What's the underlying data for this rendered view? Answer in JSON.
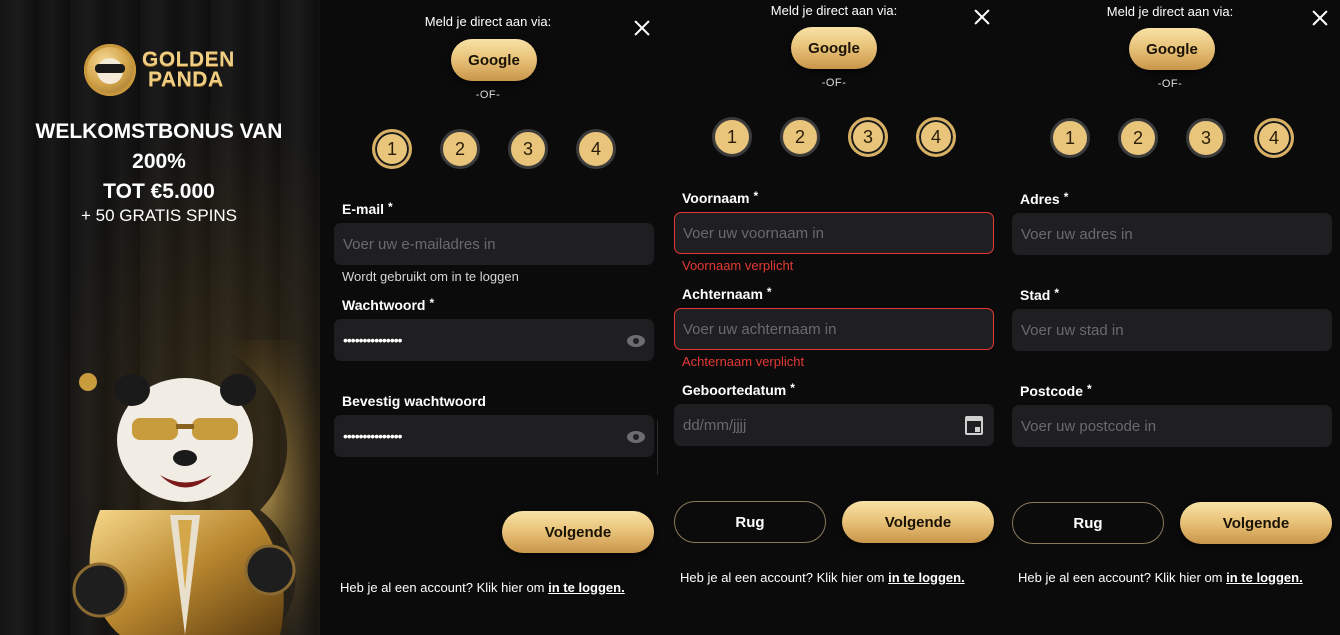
{
  "promo": {
    "logo_line1": "GOLDEN",
    "logo_line2": "PANDA",
    "headline_1": "WELKOMSTBONUS VAN",
    "headline_2": "200%",
    "headline_3": "TOT €5.000",
    "subline": "+ 50 GRATIS SPINS"
  },
  "common": {
    "meld_text": "Meld je direct aan via:",
    "google_label": "Google",
    "or_text": "-OF-",
    "steps": [
      "1",
      "2",
      "3",
      "4"
    ],
    "footer_text": "Heb je al een account? Klik hier om",
    "footer_link": "in te loggen.",
    "next_label": "Volgende",
    "back_label": "Rug",
    "required_mark": "*"
  },
  "step1": {
    "email_label": "E-mail",
    "email_placeholder": "Voer uw e-mailadres in",
    "email_hint": "Wordt gebruikt om in te loggen",
    "password_label": "Wachtwoord",
    "password_value": "•••••••••••••••",
    "confirm_label": "Bevestig wachtwoord",
    "confirm_value": "•••••••••••••••"
  },
  "step2": {
    "firstname_label": "Voornaam",
    "firstname_placeholder": "Voer uw voornaam in",
    "firstname_error": "Voornaam verplicht",
    "lastname_label": "Achternaam",
    "lastname_placeholder": "Voer uw achternaam in",
    "lastname_error": "Achternaam verplicht",
    "dob_label": "Geboortedatum",
    "dob_placeholder": "dd/mm/jjjj"
  },
  "step3": {
    "address_label": "Adres",
    "address_placeholder": "Voer uw adres in",
    "city_label": "Stad",
    "city_placeholder": "Voer uw stad in",
    "postcode_label": "Postcode",
    "postcode_placeholder": "Voer uw postcode in"
  },
  "icons": {
    "close": "close-icon",
    "eye": "eye-icon",
    "calendar": "calendar-icon"
  },
  "colors": {
    "gold": "#e9c47b",
    "error": "#e53935",
    "field_bg": "#1f1f22",
    "background": "#0b0b0c"
  }
}
